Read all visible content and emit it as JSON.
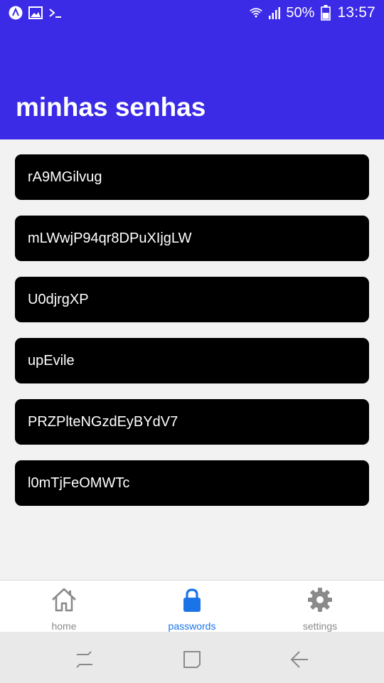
{
  "status_bar": {
    "battery_text": "50%",
    "time": "13:57",
    "icons_left": [
      "app-icon",
      "image-icon",
      "terminal-icon"
    ],
    "icons_right": [
      "wifi-icon",
      "signal-icon",
      "battery-icon"
    ]
  },
  "header": {
    "title": "minhas senhas",
    "color": "#3b2ae6"
  },
  "passwords": [
    "rA9MGilvug",
    "mLWwjP94qr8DPuXIjgLW",
    "U0djrgXP",
    "upEvile",
    "PRZPlteNGzdEyBYdV7",
    "l0mTjFeOMWTc"
  ],
  "tabs": [
    {
      "label": "home",
      "icon": "home-icon",
      "active": false
    },
    {
      "label": "passwords",
      "icon": "lock-icon",
      "active": true
    },
    {
      "label": "settings",
      "icon": "gear-icon",
      "active": false
    }
  ],
  "colors": {
    "active_tab": "#1a74e8",
    "inactive_tab": "#8a8a8a",
    "card": "#000000"
  }
}
